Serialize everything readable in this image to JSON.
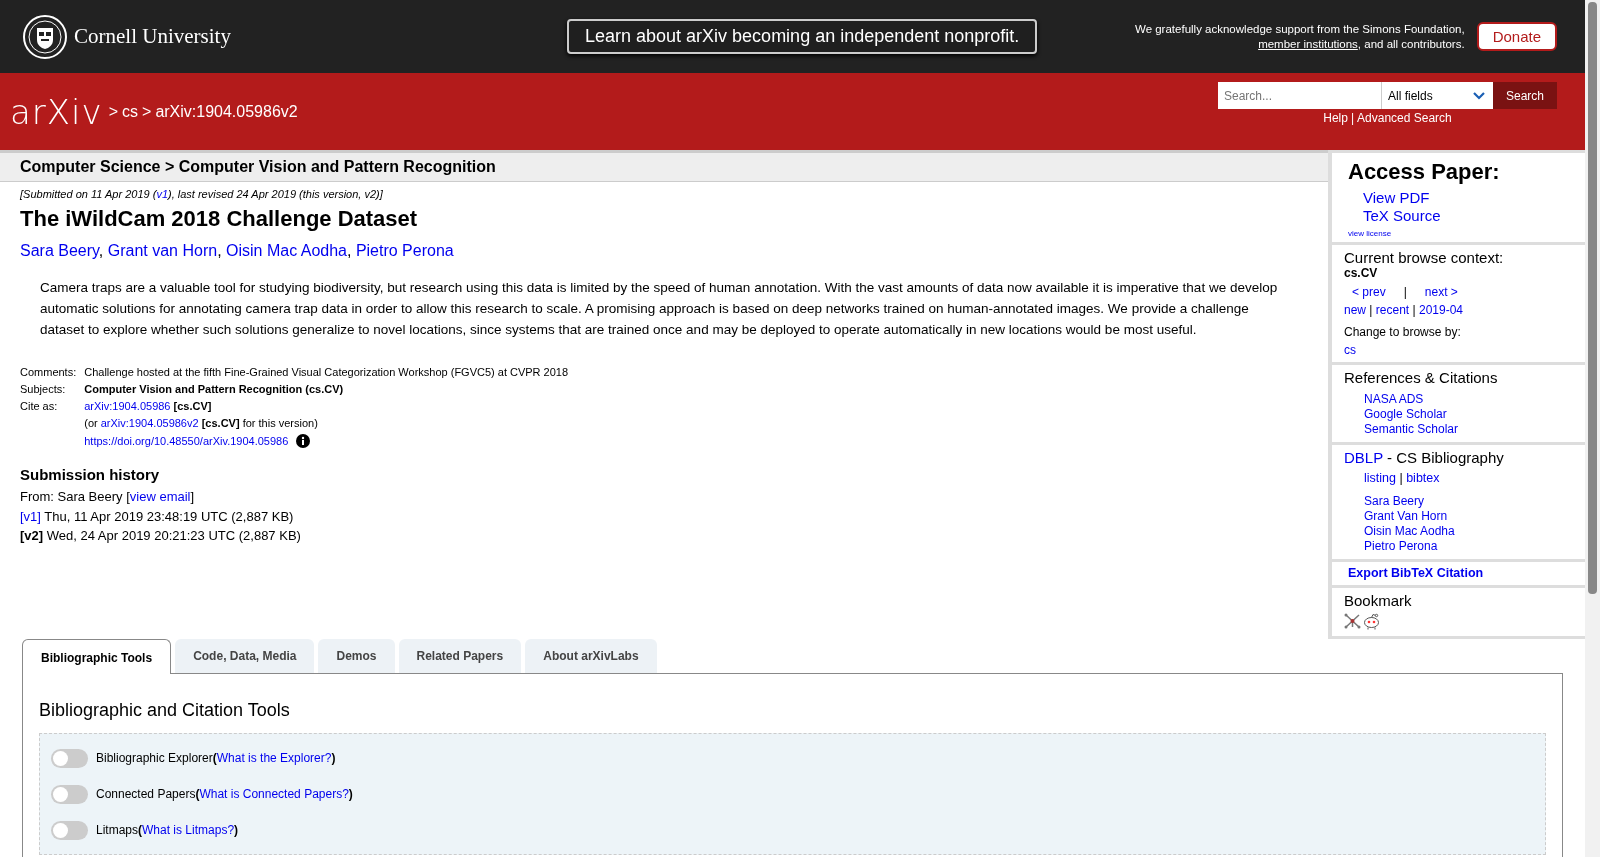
{
  "top_bar": {
    "institution": "Cornell University",
    "banner": "Learn about arXiv becoming an independent nonprofit.",
    "support": {
      "before": "We gratefully acknowledge support from the Simons Foundation, ",
      "link": "member institutions",
      "after": ", and all contributors."
    },
    "donate": "Donate"
  },
  "header": {
    "logo": "arXiv",
    "breadcrumbs": [
      {
        "sep": ">",
        "label": "cs"
      },
      {
        "sep": ">",
        "label": "arXiv:1904.05986v2"
      }
    ],
    "search": {
      "placeholder": "Search...",
      "field_select": "All fields",
      "button": "Search"
    },
    "help_links": [
      {
        "label": "Help"
      },
      {
        "label": "Advanced Search"
      }
    ],
    "help_divider": "|"
  },
  "subheader": "Computer Science > Computer Vision and Pattern Recognition",
  "dateline": {
    "before": "[Submitted on 11 Apr 2019 (",
    "link": "v1",
    "after": "), last revised 24 Apr 2019 (this version, v2)]"
  },
  "title": "The iWildCam 2018 Challenge Dataset",
  "authors": [
    "Sara Beery",
    "Grant van Horn",
    "Oisin Mac Aodha",
    "Pietro Perona"
  ],
  "author_separator": ",",
  "abstract": "Camera traps are a valuable tool for studying biodiversity, but research using this data is limited by the speed of human annotation. With the vast amounts of data now available it is imperative that we develop automatic solutions for annotating camera trap data in order to allow this research to scale. A promising approach is based on deep networks trained on human-annotated images. We provide a challenge dataset to explore whether such solutions generalize to novel locations, since systems that are trained once and may be deployed to operate automatically in new locations would be most useful.",
  "metadata": {
    "comments_label": "Comments:",
    "comments": "Challenge hosted at the fifth Fine-Grained Visual Categorization Workshop (FGVC5) at CVPR 2018",
    "subjects_label": "Subjects:",
    "subjects": "Computer Vision and Pattern Recognition (cs.CV)",
    "cite_label": "Cite as:",
    "cite_link": "arXiv:1904.05986",
    "cite_tag": "[cs.CV]",
    "version_line": {
      "before": "(or ",
      "link": "arXiv:1904.05986v2",
      "tag": "[cs.CV]",
      "after": " for this version)"
    },
    "doi": "https://doi.org/10.48550/arXiv.1904.05986"
  },
  "submission_history": {
    "heading": "Submission history",
    "from": {
      "before": "From: Sara Beery [",
      "link": "view email",
      "after": "]"
    },
    "versions": [
      {
        "label": "[v1]",
        "kind": "link",
        "details": "Thu, 11 Apr 2019 23:48:19 UTC (2,887 KB)"
      },
      {
        "label": "[v2]",
        "kind": "current",
        "details": "Wed, 24 Apr 2019 20:21:23 UTC (2,887 KB)"
      }
    ]
  },
  "sidebar": {
    "access": {
      "heading": "Access Paper:",
      "links": [
        "View PDF",
        "TeX Source"
      ],
      "license": "view license"
    },
    "browse": {
      "heading": "Current browse context:",
      "context": "cs.CV",
      "prev": "< prev",
      "divider": "|",
      "next": "next >",
      "links": [
        "new",
        "recent",
        "2019-04"
      ],
      "links_divider": "|",
      "change_label": "Change to browse by:",
      "change_links": [
        "cs"
      ]
    },
    "references": {
      "heading": "References & Citations",
      "links": [
        "NASA ADS",
        "Google Scholar",
        "Semantic Scholar"
      ]
    },
    "dblp": {
      "link": "DBLP",
      "heading": " - CS Bibliography",
      "links": [
        "listing",
        "bibtex"
      ],
      "divider": "|",
      "authors": [
        "Sara Beery",
        "Grant Van Horn",
        "Oisin Mac Aodha",
        "Pietro Perona"
      ]
    },
    "export": "Export BibTeX Citation",
    "bookmark": {
      "heading": "Bookmark"
    }
  },
  "tabs": [
    {
      "label": "Bibliographic Tools",
      "selected": true
    },
    {
      "label": "Code, Data, Media",
      "selected": false
    },
    {
      "label": "Demos",
      "selected": false
    },
    {
      "label": "Related Papers",
      "selected": false
    },
    {
      "label": "About arXivLabs",
      "selected": false
    }
  ],
  "tools": {
    "heading": "Bibliographic and Citation Tools",
    "items": [
      {
        "label": "Bibliographic Explorer",
        "open": "(",
        "help": "What is the Explorer?",
        "close": ")",
        "on": false
      },
      {
        "label": "Connected Papers",
        "open": "(",
        "help": "What is Connected Papers?",
        "close": ")",
        "on": false
      },
      {
        "label": "Litmaps",
        "open": "(",
        "help": "What is Litmaps?",
        "close": ")",
        "on": false
      }
    ]
  }
}
